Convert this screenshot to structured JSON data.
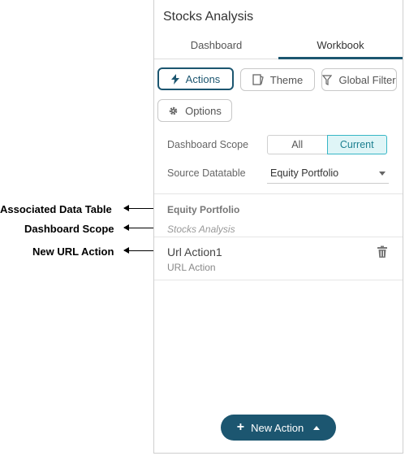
{
  "callouts": [
    {
      "label": "Associated Data Table"
    },
    {
      "label": "Dashboard Scope"
    },
    {
      "label": "New URL Action"
    }
  ],
  "panel": {
    "title": "Stocks Analysis",
    "tabs": [
      {
        "label": "Dashboard"
      },
      {
        "label": "Workbook",
        "selected": true
      }
    ],
    "buttons": {
      "actions": "Actions",
      "theme": "Theme",
      "global_filter": "Global Filter",
      "options": "Options"
    },
    "dashboard_scope": {
      "label": "Dashboard Scope",
      "options": [
        "All",
        "Current"
      ],
      "selected": "Current"
    },
    "source_datatable": {
      "label": "Source Datatable",
      "value": "Equity Portfolio"
    },
    "datasource_header": {
      "name": "Equity Portfolio",
      "scope": "Stocks Analysis"
    },
    "actions_list": [
      {
        "name": "Url Action1",
        "type": "URL Action"
      }
    ],
    "new_action_button": "New Action"
  },
  "colors": {
    "accent": "#1c5670",
    "current_bg": "#dff5f7",
    "current_border": "#37b6c6"
  }
}
